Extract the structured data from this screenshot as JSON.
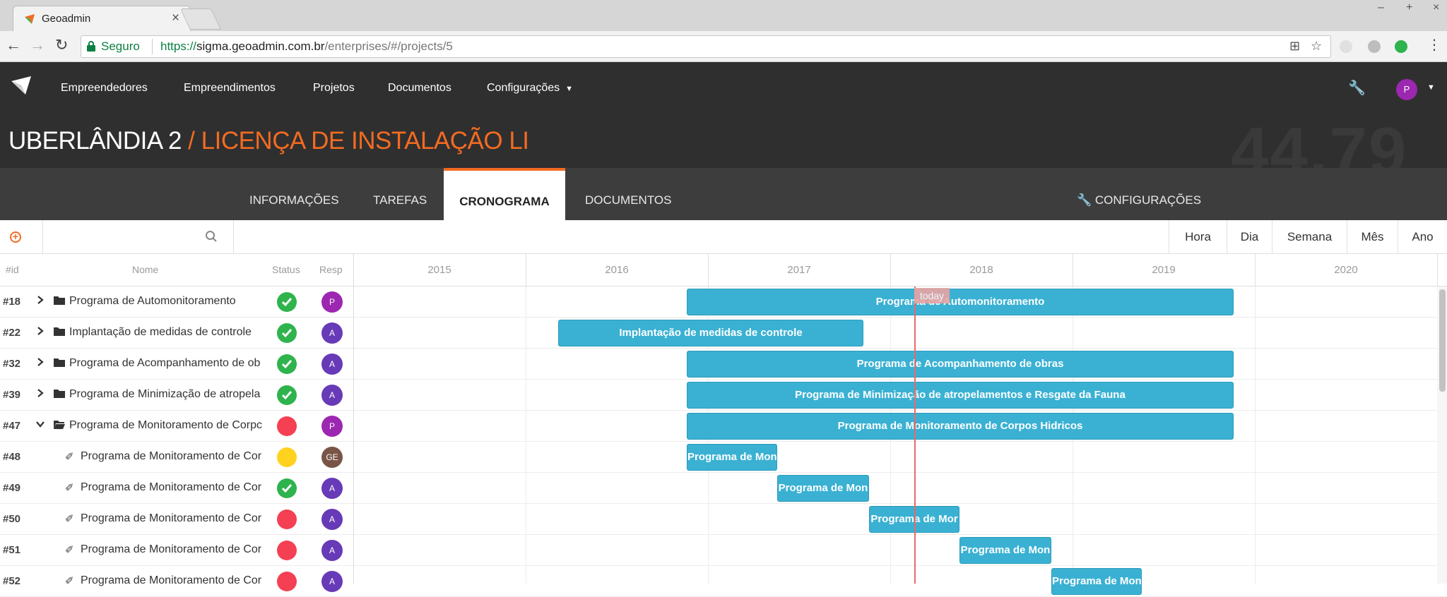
{
  "browser": {
    "tab_title": "Geoadmin",
    "tab_close": "×",
    "secure_label": "Seguro",
    "url_scheme": "https://",
    "url_host": "sigma.geoadmin.com.br",
    "url_path": "/enterprises/#/projects/5"
  },
  "nav": {
    "items": [
      "Empreendedores",
      "Empreendimentos",
      "Projetos",
      "Documentos",
      "Configurações"
    ],
    "user_initial": "P"
  },
  "project": {
    "name": "UBERLÂNDIA 2",
    "separator": " / ",
    "subtitle": "LICENÇA DE INSTALAÇÃO LI",
    "progress_percent": "44.79 %"
  },
  "tabs": {
    "items": [
      "INFORMAÇÕES",
      "TAREFAS",
      "CRONOGRAMA",
      "DOCUMENTOS"
    ],
    "active": "CRONOGRAMA",
    "settings": "CONFIGURAÇÕES"
  },
  "toolbar": {
    "zoom_options": [
      "Hora",
      "Dia",
      "Semana",
      "Mês",
      "Ano"
    ]
  },
  "grid": {
    "columns": [
      "#id",
      "Nome",
      "Status",
      "Resp"
    ],
    "years": [
      "2015",
      "2016",
      "2017",
      "2018",
      "2019",
      "2020"
    ],
    "today_label": "today",
    "rows": [
      {
        "id": "#18",
        "name": "Programa de Automonitoramento",
        "type": "folder",
        "expanded": false,
        "status": "ok",
        "resp": "P",
        "resp_color": "#9c27b0",
        "bar": "Programa de Automonitoramento"
      },
      {
        "id": "#22",
        "name": "Implantação de medidas de controle",
        "type": "folder",
        "expanded": false,
        "status": "ok",
        "resp": "A",
        "resp_color": "#673ab7",
        "bar": "Implantação de medidas de controle"
      },
      {
        "id": "#32",
        "name": "Programa de Acompanhamento de ob",
        "type": "folder",
        "expanded": false,
        "status": "ok",
        "resp": "A",
        "resp_color": "#673ab7",
        "bar": "Programa de Acompanhamento de obras"
      },
      {
        "id": "#39",
        "name": "Programa de Minimização de atropela",
        "type": "folder",
        "expanded": false,
        "status": "ok",
        "resp": "A",
        "resp_color": "#673ab7",
        "bar": "Programa de Minimização de atropelamentos e Resgate da Fauna"
      },
      {
        "id": "#47",
        "name": "Programa de Monitoramento de Corpc",
        "type": "folder",
        "expanded": true,
        "status": "late",
        "resp": "P",
        "resp_color": "#9c27b0",
        "bar": "Programa de Monitoramento de Corpos Hidricos"
      },
      {
        "id": "#48",
        "name": "Programa de Monitoramento de Cor",
        "type": "task",
        "status": "warn",
        "resp": "GE",
        "resp_color": "#795548",
        "bar": "Programa de Mon"
      },
      {
        "id": "#49",
        "name": "Programa de Monitoramento de Cor",
        "type": "task",
        "status": "ok",
        "resp": "A",
        "resp_color": "#673ab7",
        "bar": "Programa de Mon"
      },
      {
        "id": "#50",
        "name": "Programa de Monitoramento de Cor",
        "type": "task",
        "status": "late",
        "resp": "A",
        "resp_color": "#673ab7",
        "bar": "Programa de Mor"
      },
      {
        "id": "#51",
        "name": "Programa de Monitoramento de Cor",
        "type": "task",
        "status": "late",
        "resp": "A",
        "resp_color": "#673ab7",
        "bar": "Programa de Mon"
      },
      {
        "id": "#52",
        "name": "Programa de Monitoramento de Cor",
        "type": "task",
        "status": "late",
        "resp": "A",
        "resp_color": "#673ab7",
        "bar": "Programa de Mon"
      }
    ]
  },
  "colors": {
    "accent": "#f26b21",
    "bar": "#3ab1d3",
    "today": "#e76a6a",
    "status_ok": "#2eb34d",
    "status_late": "#f44052",
    "status_warn": "#ffd21f"
  }
}
